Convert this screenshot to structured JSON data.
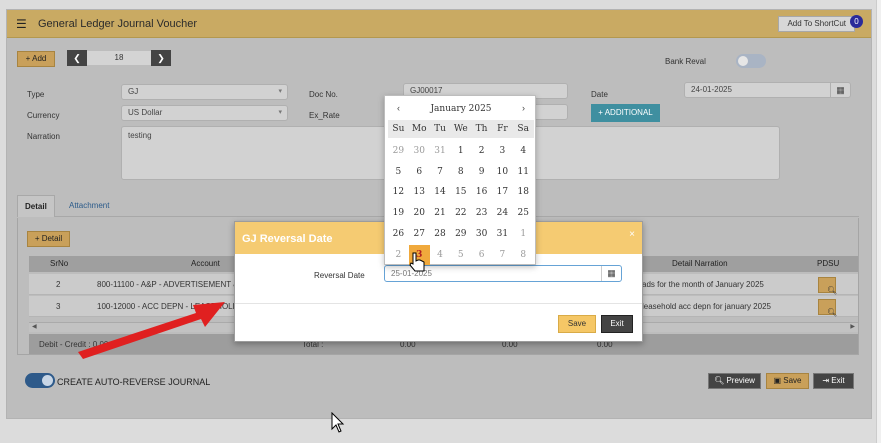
{
  "titlebar": {
    "title": "General Ledger Journal Voucher",
    "shortcut_label": "Add To ShortCut",
    "shortcut_count": "0"
  },
  "toolbar": {
    "add_label": "+ Add",
    "voucher_number": "18",
    "prev_icon": "chevron-left",
    "next_icon": "chevron-right"
  },
  "bank_reval": {
    "label": "Bank Reval",
    "enabled": false
  },
  "form": {
    "type_label": "Type",
    "type_value": "GJ",
    "currency_label": "Currency",
    "currency_value": "US Dollar",
    "narration_label": "Narration",
    "narration_value": "testing",
    "doc_no_label": "Doc No.",
    "doc_no_value": "GJ00017",
    "ex_rate_label": "Ex_Rate",
    "date_label": "Date",
    "date_value": "24-01-2025",
    "additional_label": "+ ADDITIONAL"
  },
  "tabs": [
    {
      "label": "Detail",
      "active": true
    },
    {
      "label": "Attachment",
      "active": false
    }
  ],
  "detail": {
    "add_detail_label": "+ Detail",
    "columns": {
      "srno": "SrNo",
      "account": "Account",
      "detail_narration": "Detail Narration",
      "pdsu": "PDSU"
    },
    "rows": [
      {
        "srno": "2",
        "account": "800-11100 - A&P - ADVERTISEMENT & P",
        "narration": "ads for the month of January 2025"
      },
      {
        "srno": "3",
        "account": "100-12000 - ACC DEPN - LEASEHOLD PR",
        "narration": "leasehold acc depn for january 2025"
      }
    ],
    "totals": {
      "label": "Debit - Credit : 0.00",
      "total_label": "Total :",
      "v1": "0.00",
      "v2": "0.00",
      "v3": "0.00"
    }
  },
  "auto_reverse": {
    "label": "CREATE AUTO-REVERSE JOURNAL",
    "enabled": true
  },
  "bottom_buttons": {
    "preview": "Preview",
    "save": "Save",
    "exit": "Exit"
  },
  "modal": {
    "title": "GJ Reversal Date",
    "close": "×",
    "reversal_label": "Reversal Date",
    "reversal_value": "25-01-2025",
    "save": "Save",
    "exit": "Exit"
  },
  "datepicker": {
    "month": "January 2025",
    "prev": "‹",
    "next": "›",
    "dow": [
      "Su",
      "Mo",
      "Tu",
      "We",
      "Th",
      "Fr",
      "Sa"
    ],
    "weeks": [
      [
        "29",
        "30",
        "31",
        "1",
        "2",
        "3",
        "4"
      ],
      [
        "5",
        "6",
        "7",
        "8",
        "9",
        "10",
        "11"
      ],
      [
        "12",
        "13",
        "14",
        "15",
        "16",
        "17",
        "18"
      ],
      [
        "19",
        "20",
        "21",
        "22",
        "23",
        "24",
        "25"
      ],
      [
        "26",
        "27",
        "28",
        "29",
        "30",
        "31",
        "1"
      ],
      [
        "2",
        "3",
        "4",
        "5",
        "6",
        "7",
        "8"
      ]
    ],
    "other_month": [
      [
        0,
        1,
        2
      ],
      [],
      [],
      [],
      [
        6
      ],
      [
        0,
        1,
        2,
        3,
        4,
        5,
        6
      ]
    ],
    "highlighted_day": "3",
    "highlighted_week": 5,
    "highlighted_col": 1
  },
  "colors": {
    "titlebar": "#c9aa63",
    "accent_gold": "#f5c766",
    "modal_head": "#f5cb72",
    "toggle_on": "#2e5a8a",
    "annotation_arrow": "#e02020"
  }
}
